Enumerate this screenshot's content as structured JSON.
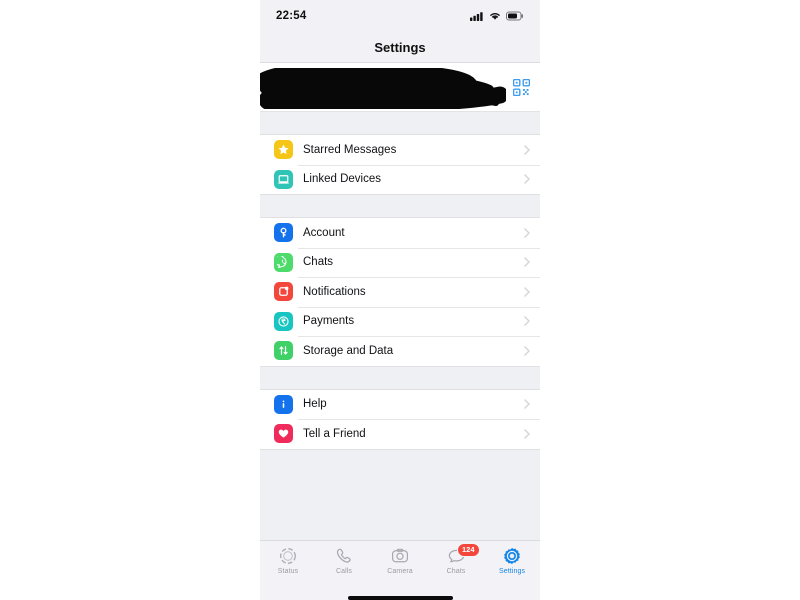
{
  "status_bar": {
    "time": "22:54",
    "icons": [
      "cellular-signal-icon",
      "wifi-icon",
      "battery-icon"
    ]
  },
  "nav": {
    "title": "Settings"
  },
  "profile": {
    "redacted": true,
    "name": "",
    "status": "",
    "qr_icon": "qr-code-icon",
    "qr_color": "#3e9cf0"
  },
  "sections": [
    {
      "id": "section-personal",
      "rows": [
        {
          "label": "Starred Messages",
          "icon": "star-icon",
          "icon_class": "ic-star",
          "color": "#f5c518"
        },
        {
          "label": "Linked Devices",
          "icon": "laptop-icon",
          "icon_class": "ic-linked",
          "color": "#2ec4b6"
        }
      ]
    },
    {
      "id": "section-app",
      "rows": [
        {
          "label": "Account",
          "icon": "key-icon",
          "icon_class": "ic-account",
          "color": "#1372ec"
        },
        {
          "label": "Chats",
          "icon": "chat-bubble-icon",
          "icon_class": "ic-chats",
          "color": "#4ddc6b"
        },
        {
          "label": "Notifications",
          "icon": "notification-icon",
          "icon_class": "ic-notif",
          "color": "#f4473c"
        },
        {
          "label": "Payments",
          "icon": "rupee-icon",
          "icon_class": "ic-payments",
          "color": "#18c5c0"
        },
        {
          "label": "Storage and Data",
          "icon": "arrows-updown-icon",
          "icon_class": "ic-storage",
          "color": "#3fd168"
        }
      ]
    },
    {
      "id": "section-support",
      "rows": [
        {
          "label": "Help",
          "icon": "info-icon",
          "icon_class": "ic-help",
          "color": "#1372ec"
        },
        {
          "label": "Tell a Friend",
          "icon": "heart-icon",
          "icon_class": "ic-friend",
          "color": "#ef2b5b"
        }
      ]
    }
  ],
  "tab_bar": {
    "active": "Settings",
    "active_color": "#1785e5",
    "inactive_color": "#9b9ba1",
    "tabs": [
      {
        "label": "Status",
        "icon": "status-ring-icon",
        "badge": ""
      },
      {
        "label": "Calls",
        "icon": "phone-icon",
        "badge": ""
      },
      {
        "label": "Camera",
        "icon": "camera-icon",
        "badge": ""
      },
      {
        "label": "Chats",
        "icon": "chat-bubble-icon",
        "badge": "124"
      },
      {
        "label": "Settings",
        "icon": "gear-icon",
        "badge": ""
      }
    ]
  }
}
